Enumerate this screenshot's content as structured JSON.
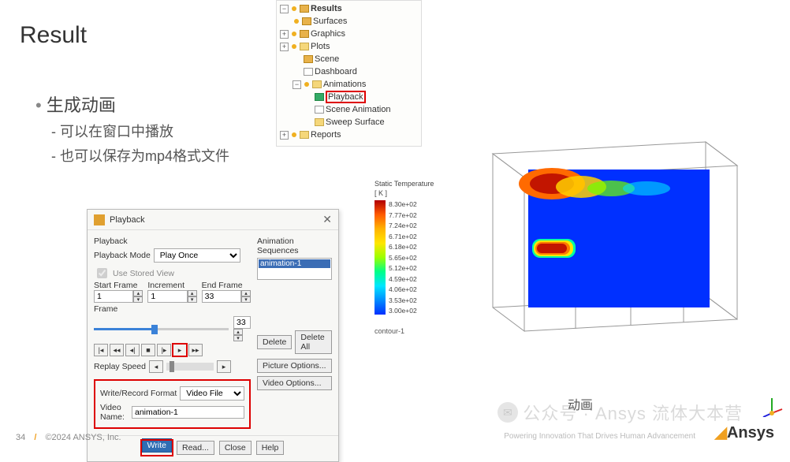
{
  "slide": {
    "title": "Result",
    "bullet1": "生成动画",
    "sub1": "可以在窗口中播放",
    "sub2": "也可以保存为mp4格式文件",
    "anim_caption": "动画",
    "page_number": "34",
    "copyright": "©2024 ANSYS, Inc.",
    "tagline": "Powering Innovation That Drives Human Advancement",
    "logo_text": "Ansys",
    "watermark": "公众号 · Ansys 流体大本营"
  },
  "tree": {
    "root": "Results",
    "items": [
      "Surfaces",
      "Graphics",
      "Plots",
      "Scene",
      "Dashboard",
      "Animations",
      "Playback",
      "Scene Animation",
      "Sweep Surface",
      "Reports"
    ]
  },
  "dialog": {
    "title": "Playback",
    "section": "Playback",
    "mode_label": "Playback Mode",
    "mode_value": "Play Once",
    "stored_view": "Use Stored View",
    "start_label": "Start Frame",
    "increment_label": "Increment",
    "end_label": "End Frame",
    "start_value": "1",
    "increment_value": "1",
    "end_value": "33",
    "frame_label": "Frame",
    "frame_value": "33",
    "replay_label": "Replay Speed",
    "wr_format_label": "Write/Record Format",
    "wr_format_value": "Video File",
    "video_name_label": "Video Name:",
    "video_name_value": "animation-1",
    "seq_title": "Animation Sequences",
    "seq_item": "animation-1",
    "btn_delete": "Delete",
    "btn_delete_all": "Delete All",
    "btn_pic": "Picture Options...",
    "btn_vid": "Video Options...",
    "btn_write": "Write",
    "btn_read": "Read...",
    "btn_close": "Close",
    "btn_help": "Help"
  },
  "legend": {
    "title": "Static Temperature",
    "unit": "[ K ]",
    "ticks": [
      "8.30e+02",
      "7.77e+02",
      "7.24e+02",
      "6.71e+02",
      "6.18e+02",
      "5.65e+02",
      "5.12e+02",
      "4.59e+02",
      "4.06e+02",
      "3.53e+02",
      "3.00e+02"
    ],
    "contour": "contour-1"
  },
  "chart_data": {
    "type": "heatmap",
    "title": "Static Temperature [K]",
    "colormap": "rainbow",
    "range_min": 300,
    "range_max": 830,
    "ticks": [
      830,
      777,
      724,
      671,
      618,
      565,
      512,
      459,
      406,
      353,
      300
    ],
    "note": "3D battery pack cross-section; hot spot near left cell and plume at top-left; background mostly ~300K"
  }
}
